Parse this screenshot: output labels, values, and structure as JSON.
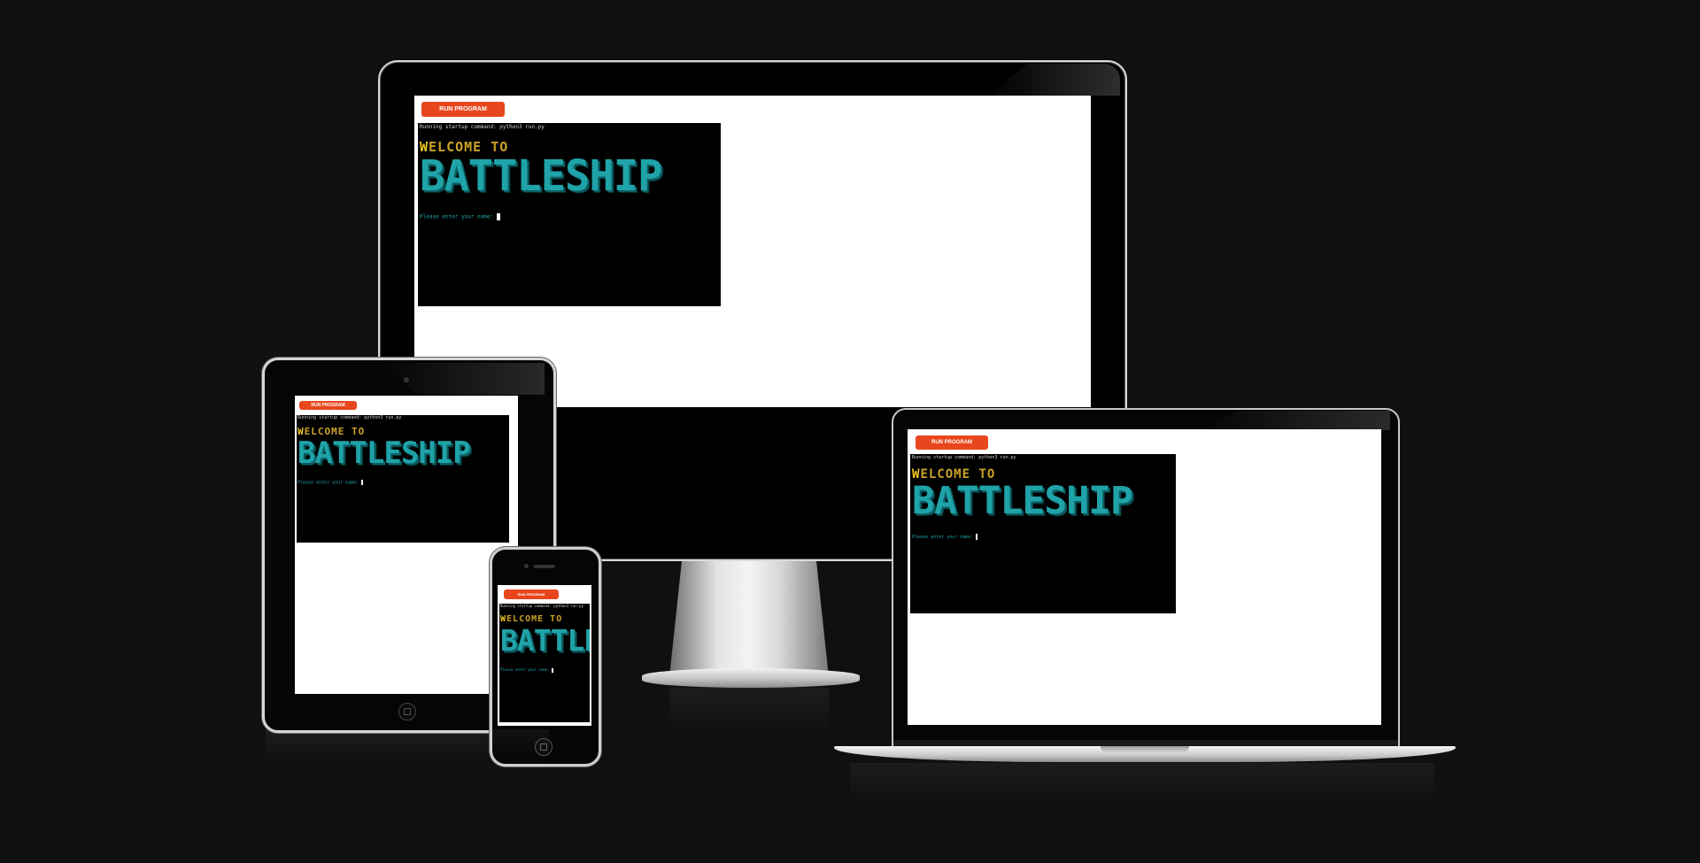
{
  "run_button_label": "RUN PROGRAM",
  "terminal": {
    "command_line": "Running startup command: python3 run.py",
    "welcome_first_letter": "W",
    "welcome_rest": "ELCOME TO",
    "title": "BATTLESHIP",
    "prompt": "Please enter your name: "
  },
  "colors": {
    "page_background": "#111011",
    "run_button": "#e8461d",
    "terminal_bg": "#000000",
    "title_color": "#1fa3a8",
    "welcome_color": "#c9a227"
  }
}
